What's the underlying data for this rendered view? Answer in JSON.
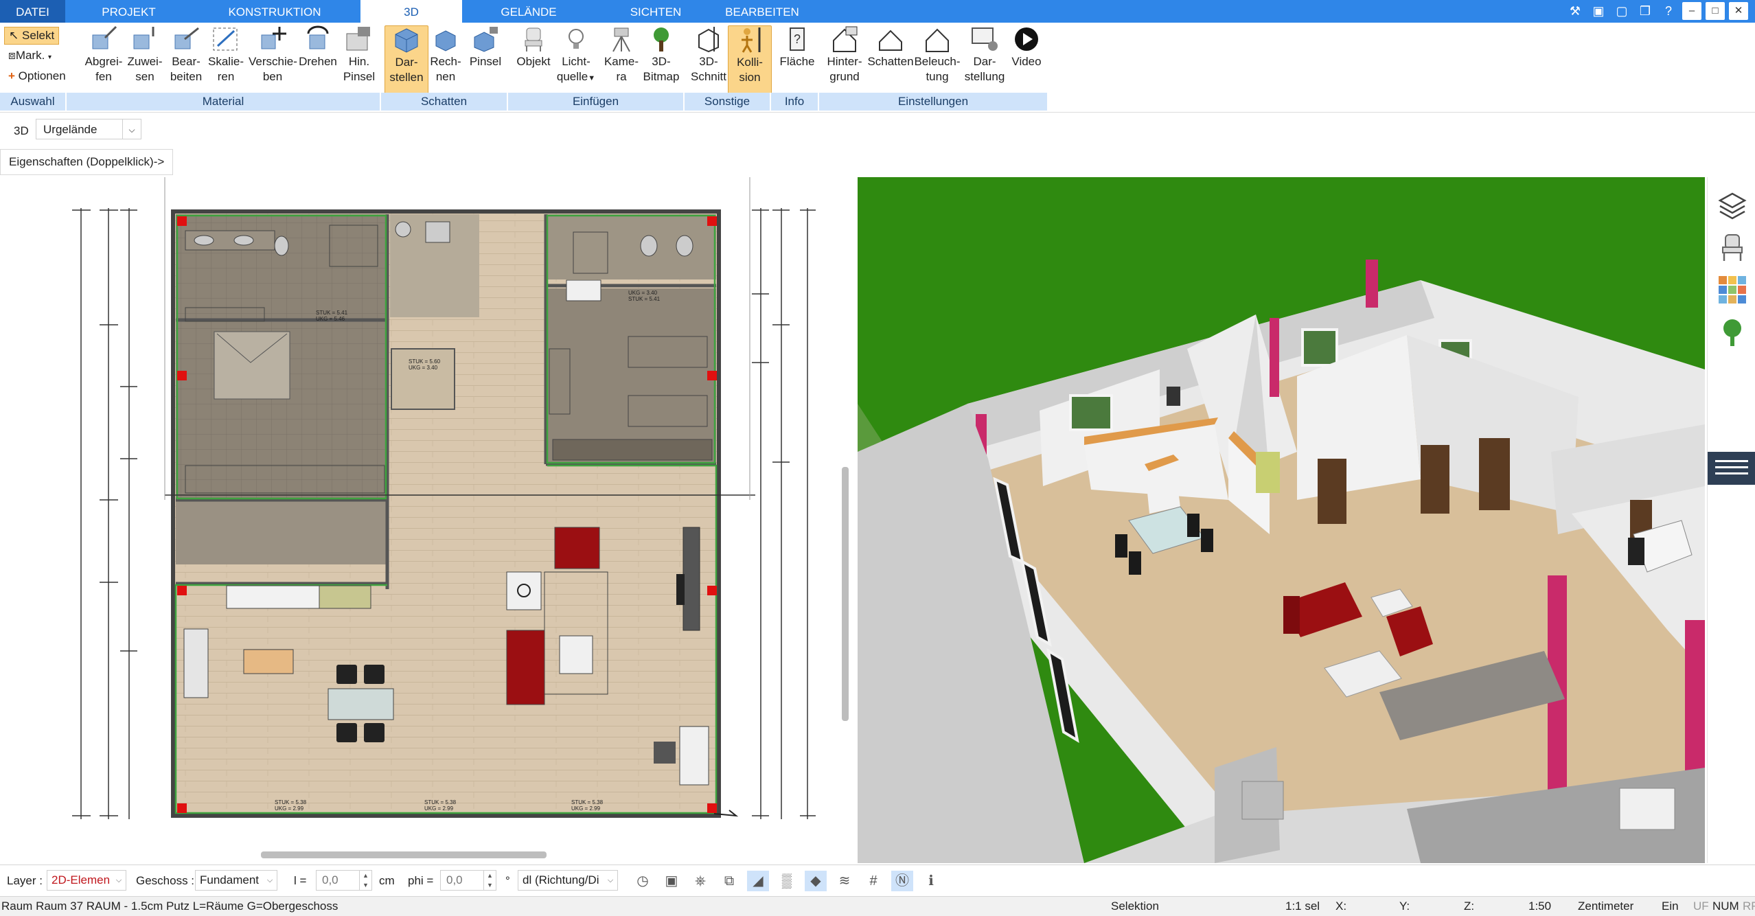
{
  "tabs": [
    "DATEI",
    "PROJEKT",
    "KONSTRUKTION",
    "3D",
    "GELÄNDE",
    "SICHTEN",
    "BEARBEITEN"
  ],
  "active_tab": "3D",
  "window_controls": [
    "tools-icon",
    "window-icon",
    "window-icon",
    "restore-icon",
    "help-icon",
    "minimize-icon",
    "maximize-icon",
    "close-icon"
  ],
  "auswahl": {
    "select_label": "Selekt",
    "mark_label": "Mark.",
    "options_label": "Optionen",
    "group": "Auswahl"
  },
  "groups": {
    "material": "Material",
    "schatten": "Schatten",
    "einfuegen": "Einfügen",
    "sonstige": "Sonstige",
    "info": "Info",
    "einstellungen": "Einstellungen"
  },
  "buttons": {
    "abgreifen": [
      "Abgrei-",
      "fen"
    ],
    "zuweisen": [
      "Zuwei-",
      "sen"
    ],
    "bearbeiten": [
      "Bear-",
      "beiten"
    ],
    "skalieren": [
      "Skalie-",
      "ren"
    ],
    "verschieben": [
      "Verschie-",
      "ben"
    ],
    "drehen": [
      "Drehen",
      ""
    ],
    "hinpinsel": [
      "Hin.",
      "Pinsel"
    ],
    "darstellen": [
      "Dar-",
      "stellen"
    ],
    "rechnen": [
      "Rech-",
      "nen"
    ],
    "pinsel": [
      "Pinsel",
      ""
    ],
    "objekt": [
      "Objekt",
      ""
    ],
    "lichtquelle": [
      "Licht-",
      "quelle"
    ],
    "kamera": [
      "Kame-",
      "ra"
    ],
    "bitmap3d": [
      "3D-",
      "Bitmap"
    ],
    "schnitt3d": [
      "3D-",
      "Schnitt"
    ],
    "kollision": [
      "Kolli-",
      "sion"
    ],
    "flaeche": [
      "Fläche",
      ""
    ],
    "hintergrund": [
      "Hinter-",
      "grund"
    ],
    "schatten": [
      "Schatten",
      ""
    ],
    "beleuchtung": [
      "Beleuch-",
      "tung"
    ],
    "darstellung": [
      "Dar-",
      "stellung"
    ],
    "video": [
      "Video",
      ""
    ]
  },
  "row2": {
    "view_label": "3D",
    "terrain_value": "Urgelände",
    "properties_button": "Eigenschaften (Doppelklick)->"
  },
  "plan_labels": {
    "stuk_bottom": [
      "STUK = 5.38",
      "STUK = 5.38",
      "STUK = 5.38"
    ],
    "ukg_bottom": [
      "UKG = 2.99",
      "UKG = 2.99",
      "UKG = 2.99"
    ],
    "room_small": [
      "STUK = 5.60",
      "UKG = 3.40"
    ],
    "room_tl": [
      "STUK = 5.41",
      "UKG = 5.46"
    ],
    "room_tr": [
      "UKG = 3.40",
      "STUK = 5.41"
    ]
  },
  "bottom": {
    "layer_label": "Layer :",
    "layer_value": "2D-Elemen",
    "geschoss_label": "Geschoss :",
    "geschoss_value": "Fundament",
    "l_label": "l =",
    "l_value": "0,0",
    "l_unit": "cm",
    "phi_label": "phi =",
    "phi_value": "0,0",
    "phi_unit": "°",
    "dir_value": "dl (Richtung/Di"
  },
  "status": {
    "info": "Raum Raum 37 RAUM - 1.5cm Putz L=Räume G=Obergeschoss",
    "mode": "Selektion",
    "selcount": "1:1 sel",
    "x": "X:",
    "y": "Y:",
    "z": "Z:",
    "scale": "1:50",
    "unit": "Zentimeter",
    "ein": "Ein",
    "uf": "UF",
    "num": "NUM",
    "rf": "RF"
  },
  "colors": {
    "tabbar": "#2f86e8",
    "accent_selected": "#fbd58a",
    "group_bar": "#cfe3fa",
    "grass": "#2f8a10",
    "floor": "#d7bf9a",
    "sofa_red": "#9b0f12",
    "wall_pink": "#d43a7a"
  }
}
